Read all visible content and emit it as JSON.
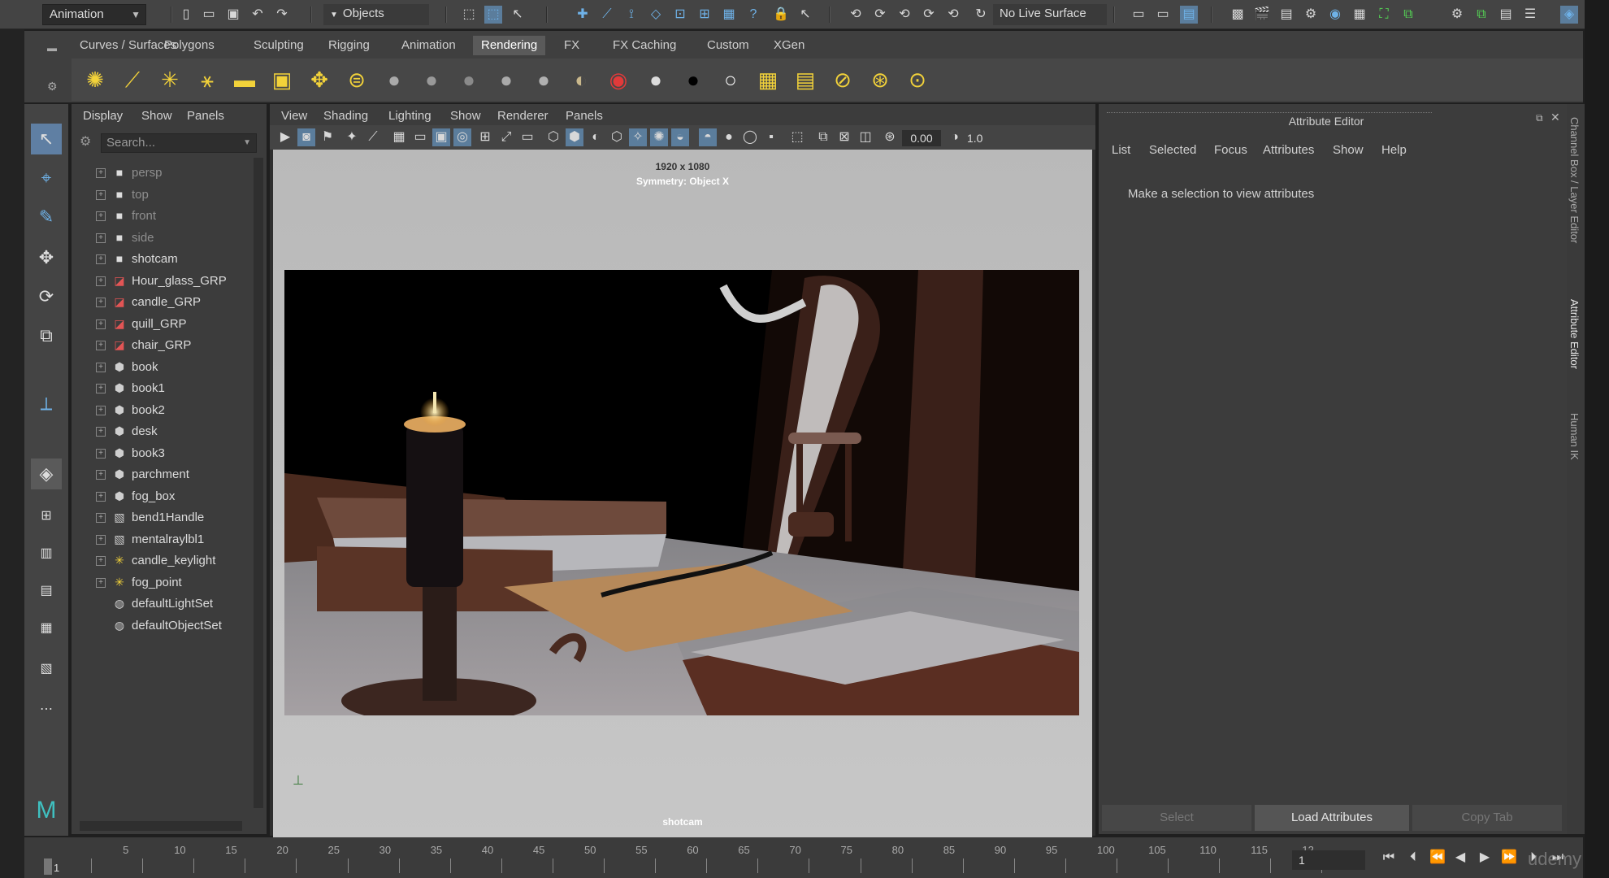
{
  "statusline": {
    "mode_menu": "Animation",
    "selection_mask": "Objects",
    "live_surface": "No Live Surface"
  },
  "shelf": {
    "tabs": [
      "Curves / Surfaces",
      "Polygons",
      "Sculpting",
      "Rigging",
      "Animation",
      "Rendering",
      "FX",
      "FX Caching",
      "Custom",
      "XGen"
    ],
    "active_tab": "Rendering"
  },
  "outliner": {
    "menu": [
      "Display",
      "Show",
      "Panels"
    ],
    "search_placeholder": "Search...",
    "items": [
      {
        "label": "persp",
        "icon": "camera-icon",
        "dim": true
      },
      {
        "label": "top",
        "icon": "camera-icon",
        "dim": true
      },
      {
        "label": "front",
        "icon": "camera-icon",
        "dim": true
      },
      {
        "label": "side",
        "icon": "camera-icon",
        "dim": true
      },
      {
        "label": "shotcam",
        "icon": "camera-icon",
        "dim": false
      },
      {
        "label": "Hour_glass_GRP",
        "icon": "group-icon",
        "dim": false
      },
      {
        "label": "candle_GRP",
        "icon": "group-icon",
        "dim": false
      },
      {
        "label": "quill_GRP",
        "icon": "group-icon",
        "dim": false
      },
      {
        "label": "chair_GRP",
        "icon": "group-icon",
        "dim": false
      },
      {
        "label": "book",
        "icon": "mesh-icon",
        "dim": false
      },
      {
        "label": "book1",
        "icon": "mesh-icon",
        "dim": false
      },
      {
        "label": "book2",
        "icon": "mesh-icon",
        "dim": false
      },
      {
        "label": "desk",
        "icon": "mesh-icon",
        "dim": false
      },
      {
        "label": "book3",
        "icon": "mesh-icon",
        "dim": false
      },
      {
        "label": "parchment",
        "icon": "mesh-icon",
        "dim": false
      },
      {
        "label": "fog_box",
        "icon": "mesh-icon",
        "dim": false
      },
      {
        "label": "bend1Handle",
        "icon": "handle-icon",
        "dim": false
      },
      {
        "label": "mentalraylbl1",
        "icon": "handle-icon",
        "dim": false
      },
      {
        "label": "candle_keylight",
        "icon": "light-icon",
        "dim": false
      },
      {
        "label": "fog_point",
        "icon": "light-icon",
        "dim": false
      },
      {
        "label": "defaultLightSet",
        "icon": "set-icon",
        "dim": false
      },
      {
        "label": "defaultObjectSet",
        "icon": "set-icon",
        "dim": false
      }
    ]
  },
  "viewport": {
    "menu": [
      "View",
      "Shading",
      "Lighting",
      "Show",
      "Renderer",
      "Panels"
    ],
    "exposure_value": "0.00",
    "gamma_value": "1.0",
    "resolution": "1920 x 1080",
    "symmetry": "Symmetry: Object X",
    "camera_name": "shotcam"
  },
  "attribute_editor": {
    "title": "Attribute Editor",
    "menu": [
      "List",
      "Selected",
      "Focus",
      "Attributes",
      "Show",
      "Help"
    ],
    "message": "Make a selection to view attributes",
    "buttons": [
      "Select",
      "Load Attributes",
      "Copy Tab"
    ]
  },
  "side_tabs": [
    "Channel Box / Layer Editor",
    "Attribute Editor",
    "Human IK"
  ],
  "timeslider": {
    "ticks": [
      "1",
      "5",
      "10",
      "15",
      "20",
      "25",
      "30",
      "35",
      "40",
      "45",
      "50",
      "55",
      "60",
      "65",
      "70",
      "75",
      "80",
      "85",
      "90",
      "95",
      "100",
      "105",
      "110",
      "115",
      "12"
    ],
    "current_frame": "1"
  },
  "watermark": "udemy"
}
